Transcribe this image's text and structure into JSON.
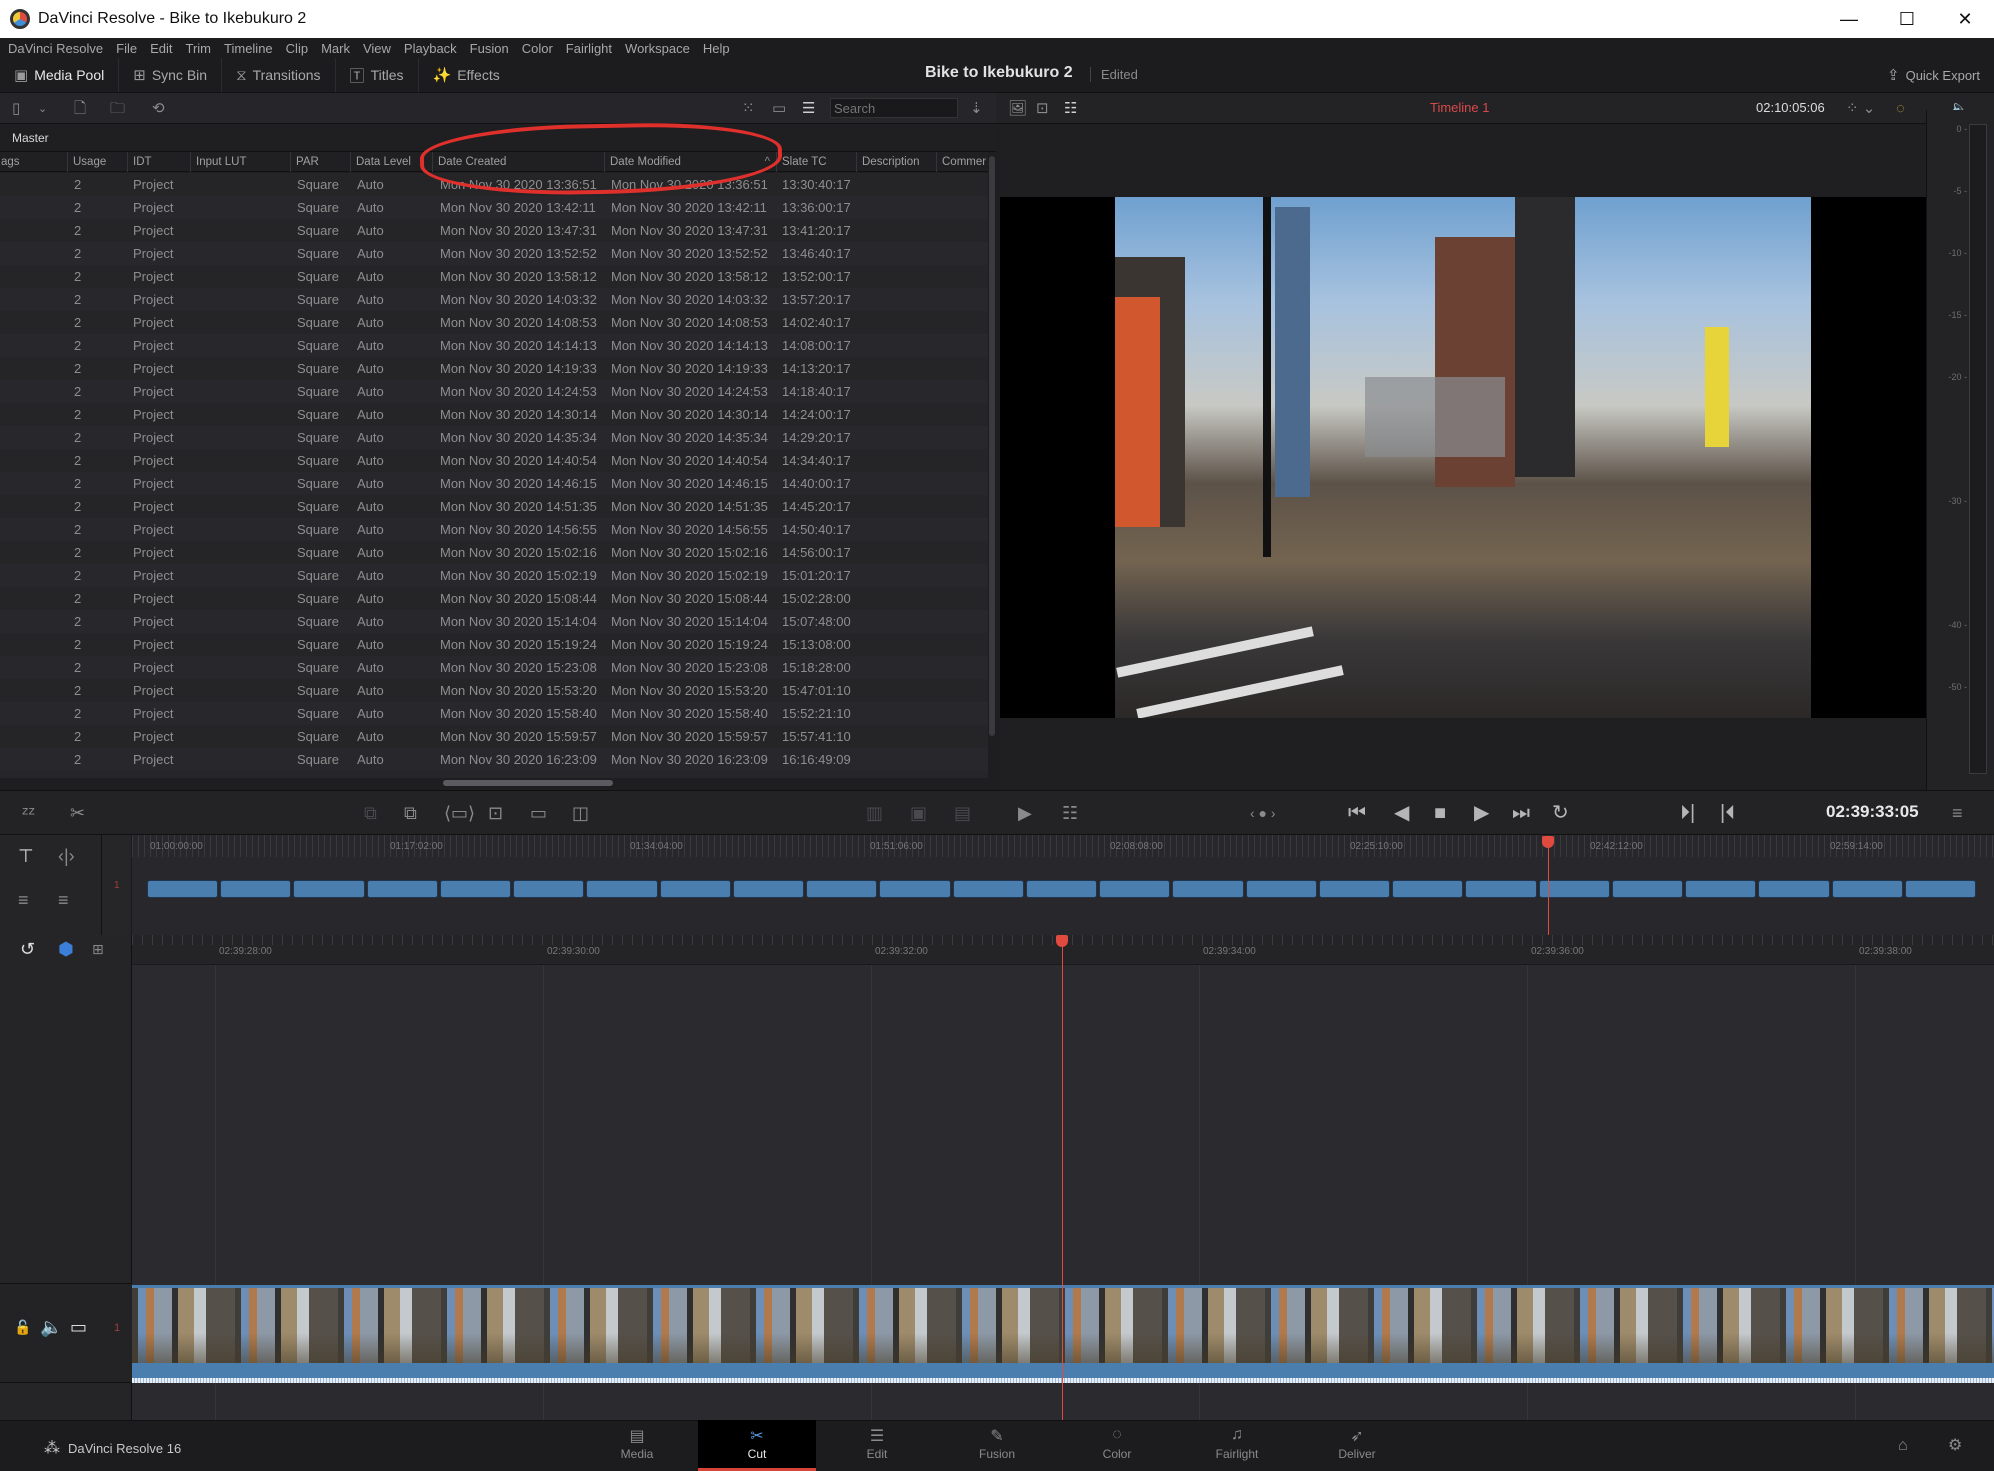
{
  "window": {
    "title": "DaVinci Resolve - Bike to Ikebukuro 2",
    "controls": {
      "minimize": "—",
      "maximize": "☐",
      "close": "✕"
    }
  },
  "menu": [
    "DaVinci Resolve",
    "File",
    "Edit",
    "Trim",
    "Timeline",
    "Clip",
    "Mark",
    "View",
    "Playback",
    "Fusion",
    "Color",
    "Fairlight",
    "Workspace",
    "Help"
  ],
  "toolbar": {
    "media_pool": "Media Pool",
    "sync_bin": "Sync Bin",
    "transitions": "Transitions",
    "titles": "Titles",
    "effects": "Effects",
    "project_title": "Bike to Ikebukuro 2",
    "project_status": "Edited",
    "quick_export": "Quick Export"
  },
  "media_pool": {
    "search_placeholder": "Search",
    "bin": "Master",
    "columns": [
      "ags",
      "Usage",
      "IDT",
      "Input LUT",
      "PAR",
      "Data Level",
      "Date Created",
      "Date Modified",
      "Slate TC",
      "Description",
      "Commer"
    ],
    "sort_column": "Date Modified",
    "sort_direction": "ascending",
    "rows": [
      {
        "usage": "2",
        "idt": "Project",
        "par": "Square",
        "level": "Auto",
        "created": "Mon Nov 30 2020 13:36:51",
        "modified": "Mon Nov 30 2020 13:36:51",
        "slate": "13:30:40:17"
      },
      {
        "usage": "2",
        "idt": "Project",
        "par": "Square",
        "level": "Auto",
        "created": "Mon Nov 30 2020 13:42:11",
        "modified": "Mon Nov 30 2020 13:42:11",
        "slate": "13:36:00:17"
      },
      {
        "usage": "2",
        "idt": "Project",
        "par": "Square",
        "level": "Auto",
        "created": "Mon Nov 30 2020 13:47:31",
        "modified": "Mon Nov 30 2020 13:47:31",
        "slate": "13:41:20:17"
      },
      {
        "usage": "2",
        "idt": "Project",
        "par": "Square",
        "level": "Auto",
        "created": "Mon Nov 30 2020 13:52:52",
        "modified": "Mon Nov 30 2020 13:52:52",
        "slate": "13:46:40:17"
      },
      {
        "usage": "2",
        "idt": "Project",
        "par": "Square",
        "level": "Auto",
        "created": "Mon Nov 30 2020 13:58:12",
        "modified": "Mon Nov 30 2020 13:58:12",
        "slate": "13:52:00:17"
      },
      {
        "usage": "2",
        "idt": "Project",
        "par": "Square",
        "level": "Auto",
        "created": "Mon Nov 30 2020 14:03:32",
        "modified": "Mon Nov 30 2020 14:03:32",
        "slate": "13:57:20:17"
      },
      {
        "usage": "2",
        "idt": "Project",
        "par": "Square",
        "level": "Auto",
        "created": "Mon Nov 30 2020 14:08:53",
        "modified": "Mon Nov 30 2020 14:08:53",
        "slate": "14:02:40:17"
      },
      {
        "usage": "2",
        "idt": "Project",
        "par": "Square",
        "level": "Auto",
        "created": "Mon Nov 30 2020 14:14:13",
        "modified": "Mon Nov 30 2020 14:14:13",
        "slate": "14:08:00:17"
      },
      {
        "usage": "2",
        "idt": "Project",
        "par": "Square",
        "level": "Auto",
        "created": "Mon Nov 30 2020 14:19:33",
        "modified": "Mon Nov 30 2020 14:19:33",
        "slate": "14:13:20:17"
      },
      {
        "usage": "2",
        "idt": "Project",
        "par": "Square",
        "level": "Auto",
        "created": "Mon Nov 30 2020 14:24:53",
        "modified": "Mon Nov 30 2020 14:24:53",
        "slate": "14:18:40:17"
      },
      {
        "usage": "2",
        "idt": "Project",
        "par": "Square",
        "level": "Auto",
        "created": "Mon Nov 30 2020 14:30:14",
        "modified": "Mon Nov 30 2020 14:30:14",
        "slate": "14:24:00:17"
      },
      {
        "usage": "2",
        "idt": "Project",
        "par": "Square",
        "level": "Auto",
        "created": "Mon Nov 30 2020 14:35:34",
        "modified": "Mon Nov 30 2020 14:35:34",
        "slate": "14:29:20:17"
      },
      {
        "usage": "2",
        "idt": "Project",
        "par": "Square",
        "level": "Auto",
        "created": "Mon Nov 30 2020 14:40:54",
        "modified": "Mon Nov 30 2020 14:40:54",
        "slate": "14:34:40:17"
      },
      {
        "usage": "2",
        "idt": "Project",
        "par": "Square",
        "level": "Auto",
        "created": "Mon Nov 30 2020 14:46:15",
        "modified": "Mon Nov 30 2020 14:46:15",
        "slate": "14:40:00:17"
      },
      {
        "usage": "2",
        "idt": "Project",
        "par": "Square",
        "level": "Auto",
        "created": "Mon Nov 30 2020 14:51:35",
        "modified": "Mon Nov 30 2020 14:51:35",
        "slate": "14:45:20:17"
      },
      {
        "usage": "2",
        "idt": "Project",
        "par": "Square",
        "level": "Auto",
        "created": "Mon Nov 30 2020 14:56:55",
        "modified": "Mon Nov 30 2020 14:56:55",
        "slate": "14:50:40:17"
      },
      {
        "usage": "2",
        "idt": "Project",
        "par": "Square",
        "level": "Auto",
        "created": "Mon Nov 30 2020 15:02:16",
        "modified": "Mon Nov 30 2020 15:02:16",
        "slate": "14:56:00:17"
      },
      {
        "usage": "2",
        "idt": "Project",
        "par": "Square",
        "level": "Auto",
        "created": "Mon Nov 30 2020 15:02:19",
        "modified": "Mon Nov 30 2020 15:02:19",
        "slate": "15:01:20:17"
      },
      {
        "usage": "2",
        "idt": "Project",
        "par": "Square",
        "level": "Auto",
        "created": "Mon Nov 30 2020 15:08:44",
        "modified": "Mon Nov 30 2020 15:08:44",
        "slate": "15:02:28:00"
      },
      {
        "usage": "2",
        "idt": "Project",
        "par": "Square",
        "level": "Auto",
        "created": "Mon Nov 30 2020 15:14:04",
        "modified": "Mon Nov 30 2020 15:14:04",
        "slate": "15:07:48:00"
      },
      {
        "usage": "2",
        "idt": "Project",
        "par": "Square",
        "level": "Auto",
        "created": "Mon Nov 30 2020 15:19:24",
        "modified": "Mon Nov 30 2020 15:19:24",
        "slate": "15:13:08:00"
      },
      {
        "usage": "2",
        "idt": "Project",
        "par": "Square",
        "level": "Auto",
        "created": "Mon Nov 30 2020 15:23:08",
        "modified": "Mon Nov 30 2020 15:23:08",
        "slate": "15:18:28:00"
      },
      {
        "usage": "2",
        "idt": "Project",
        "par": "Square",
        "level": "Auto",
        "created": "Mon Nov 30 2020 15:53:20",
        "modified": "Mon Nov 30 2020 15:53:20",
        "slate": "15:47:01:10"
      },
      {
        "usage": "2",
        "idt": "Project",
        "par": "Square",
        "level": "Auto",
        "created": "Mon Nov 30 2020 15:58:40",
        "modified": "Mon Nov 30 2020 15:58:40",
        "slate": "15:52:21:10"
      },
      {
        "usage": "2",
        "idt": "Project",
        "par": "Square",
        "level": "Auto",
        "created": "Mon Nov 30 2020 15:59:57",
        "modified": "Mon Nov 30 2020 15:59:57",
        "slate": "15:57:41:10"
      },
      {
        "usage": "2",
        "idt": "Project",
        "par": "Square",
        "level": "Auto",
        "created": "Mon Nov 30 2020 16:23:09",
        "modified": "Mon Nov 30 2020 16:23:09",
        "slate": "16:16:49:09"
      }
    ]
  },
  "viewer": {
    "timeline_name": "Timeline 1",
    "timecode": "02:10:05:06",
    "accent": "#d84a4a"
  },
  "audio_meter": {
    "ticks": [
      "0",
      "-5",
      "-10",
      "-15",
      "-20",
      "-30",
      "-40",
      "-50"
    ]
  },
  "transport": {
    "timecode": "02:39:33:05"
  },
  "upper_timeline": {
    "ruler": [
      "01:00:00:00",
      "01:17:02:00",
      "01:34:04:00",
      "01:51:06:00",
      "02:08:08:00",
      "02:25:10:00",
      "02:42:12:00",
      "02:59:14:00"
    ],
    "track": "1",
    "clip_count": 25,
    "playhead_fraction": 0.757
  },
  "lower_timeline": {
    "ruler": [
      "02:39:28:00",
      "02:39:30:00",
      "02:39:32:00",
      "02:39:34:00",
      "02:39:36:00",
      "02:39:38:00"
    ],
    "track": "1"
  },
  "bottom_nav": {
    "brand": "DaVinci Resolve 16",
    "tabs": [
      {
        "label": "Media",
        "icon": "▤"
      },
      {
        "label": "Cut",
        "icon": "✂"
      },
      {
        "label": "Edit",
        "icon": "☰"
      },
      {
        "label": "Fusion",
        "icon": "✎"
      },
      {
        "label": "Color",
        "icon": "◌"
      },
      {
        "label": "Fairlight",
        "icon": "♫"
      },
      {
        "label": "Deliver",
        "icon": "➶"
      }
    ],
    "active": "Cut"
  }
}
